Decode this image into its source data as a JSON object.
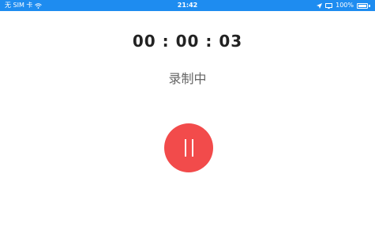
{
  "status_bar": {
    "carrier": "无 SIM 卡",
    "time": "21:42",
    "battery": "100%",
    "bg_color": "#1e8cf0"
  },
  "recorder": {
    "elapsed": "00 : 00 : 03",
    "state_label": "录制中",
    "pause_button_color": "#f24b4b",
    "pause_icon": "pause-icon"
  }
}
